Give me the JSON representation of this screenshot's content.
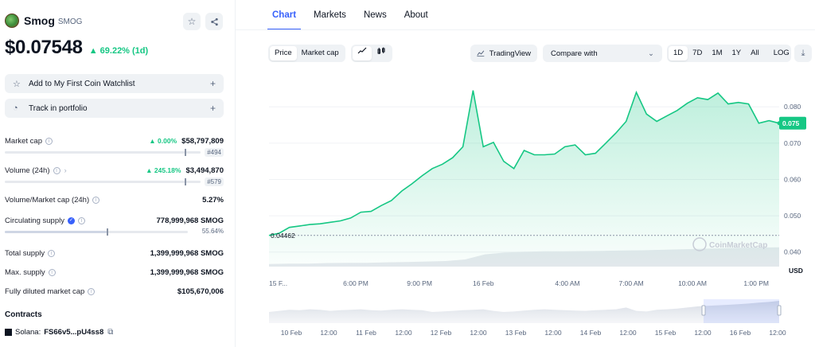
{
  "coin": {
    "name": "Smog",
    "symbol": "SMOG",
    "price": "$0.07548",
    "change_1d": "69.22% (1d)"
  },
  "actions": {
    "watchlist": "Add to My First Coin Watchlist",
    "portfolio": "Track in portfolio"
  },
  "stats": {
    "market_cap": {
      "label": "Market cap",
      "change": "0.00%",
      "value": "$58,797,809",
      "rank": "#494"
    },
    "volume": {
      "label": "Volume (24h)",
      "change": "245.18%",
      "value": "$3,494,870",
      "rank": "#579"
    },
    "vol_mcap": {
      "label": "Volume/Market cap (24h)",
      "value": "5.27%"
    },
    "circulating": {
      "label": "Circulating supply",
      "value": "778,999,968 SMOG",
      "percent": "55.64%",
      "fraction": 0.5564
    },
    "total_supply": {
      "label": "Total supply",
      "value": "1,399,999,968 SMOG"
    },
    "max_supply": {
      "label": "Max. supply",
      "value": "1,399,999,968 SMOG"
    },
    "fdv": {
      "label": "Fully diluted market cap",
      "value": "$105,670,006"
    }
  },
  "contracts": {
    "title": "Contracts",
    "chain": "Solana:",
    "address": "FS66v5...pU4ss8"
  },
  "tabs": [
    "Chart",
    "Markets",
    "News",
    "About"
  ],
  "toolbar": {
    "price": "Price",
    "market_cap": "Market cap",
    "tradingview": "TradingView",
    "compare": "Compare with",
    "ranges": [
      "1D",
      "7D",
      "1M",
      "1Y",
      "All"
    ],
    "log": "LOG"
  },
  "colors": {
    "accent": "#3861fb",
    "up": "#16c784"
  },
  "chart_data": {
    "type": "area",
    "currency": "USD",
    "watermark": "CoinMarketCap",
    "start_price_label": "0.04462",
    "current_price_label": "0.075",
    "y_ticks": [
      "0.080",
      "0.070",
      "0.060",
      "0.050",
      "0.040"
    ],
    "ylim": [
      0.036,
      0.0875
    ],
    "x_tick_labels": [
      "15 F...",
      "6:00 PM",
      "9:00 PM",
      "16 Feb",
      "4:00 AM",
      "7:00 AM",
      "10:00 AM",
      "1:00 PM"
    ],
    "x": [
      0,
      2,
      4,
      6,
      8,
      10,
      12,
      14,
      16,
      18,
      20,
      22,
      24,
      26,
      28,
      30,
      32,
      34,
      36,
      38,
      40,
      42,
      44,
      46,
      48,
      50,
      52,
      54,
      56,
      58,
      60,
      62,
      64,
      66,
      68,
      70,
      72,
      74,
      76,
      78,
      80,
      82,
      84,
      86,
      88,
      90,
      92,
      94,
      96,
      98,
      100
    ],
    "values": [
      0.0446,
      0.0452,
      0.0468,
      0.0472,
      0.0476,
      0.0478,
      0.0482,
      0.0486,
      0.0494,
      0.051,
      0.0512,
      0.0528,
      0.0542,
      0.0568,
      0.0588,
      0.061,
      0.063,
      0.0642,
      0.066,
      0.069,
      0.0845,
      0.069,
      0.0702,
      0.065,
      0.063,
      0.068,
      0.0668,
      0.0668,
      0.067,
      0.069,
      0.0695,
      0.0668,
      0.0672,
      0.07,
      0.0728,
      0.076,
      0.084,
      0.078,
      0.076,
      0.0775,
      0.079,
      0.081,
      0.0825,
      0.082,
      0.0838,
      0.0808,
      0.0812,
      0.0808,
      0.0755,
      0.0762,
      0.0755
    ],
    "volume": [
      0.1,
      0.12,
      0.12,
      0.14,
      0.15,
      0.15,
      0.17,
      0.18,
      0.2,
      0.22,
      0.28,
      0.48,
      0.55,
      0.58,
      0.6,
      0.6,
      0.61,
      0.62,
      0.63,
      0.64,
      0.66,
      0.68,
      0.7,
      0.72,
      0.74,
      0.75,
      0.76
    ],
    "navigator_labels": [
      "10 Feb",
      "12:00",
      "11 Feb",
      "12:00",
      "12 Feb",
      "12:00",
      "13 Feb",
      "12:00",
      "14 Feb",
      "12:00",
      "15 Feb",
      "12:00",
      "16 Feb",
      "12:00"
    ]
  }
}
